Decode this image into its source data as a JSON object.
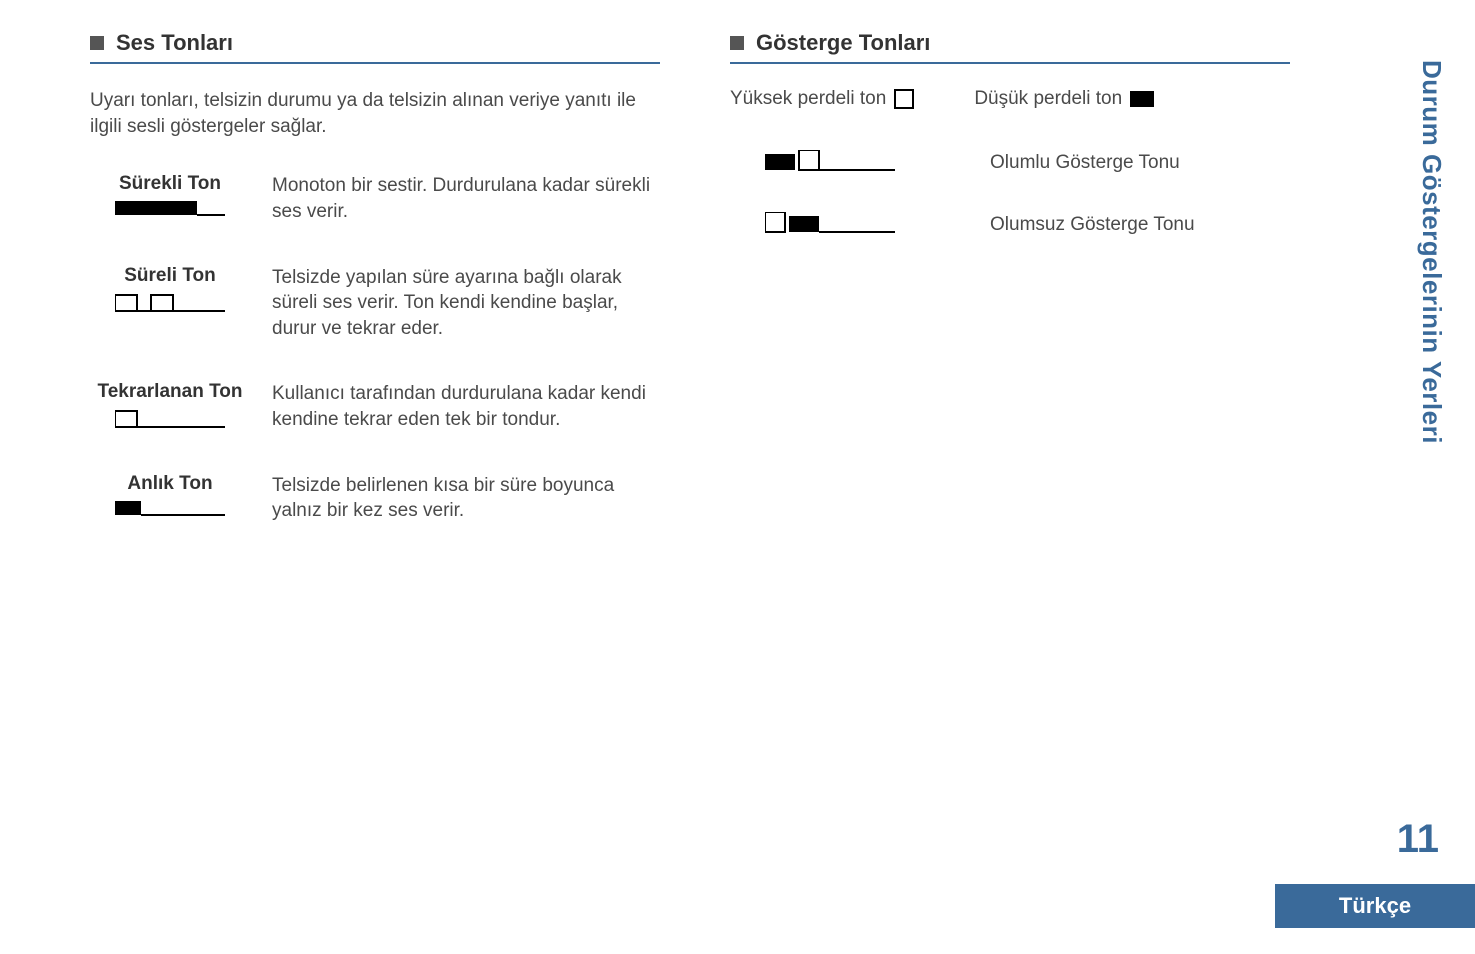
{
  "left": {
    "header": "Ses Tonları",
    "intro": "Uyarı tonları, telsizin durumu ya da telsizin alınan veriye yanıtı ile ilgili sesli göstergeler sağlar.",
    "tones": [
      {
        "label": "Sürekli Ton",
        "desc": "Monoton bir sestir. Durdurulana kadar sürekli ses verir.",
        "icon": "continuous"
      },
      {
        "label": "Süreli Ton",
        "desc": "Telsizde yapılan süre ayarına bağlı olarak süreli ses verir. Ton kendi kendine başlar, durur ve tekrar eder.",
        "icon": "periodic"
      },
      {
        "label": "Tekrarlanan Ton",
        "desc": "Kullanıcı tarafından durdurulana kadar kendi kendine tekrar eden tek bir tondur.",
        "icon": "repetitive"
      },
      {
        "label": "Anlık Ton",
        "desc": "Telsizde belirlenen kısa bir süre boyunca yalnız bir kez ses verir.",
        "icon": "momentary"
      }
    ]
  },
  "right": {
    "header": "Gösterge Tonları",
    "legend_high": "Yüksek perdeli ton",
    "legend_low": "Düşük perdeli ton",
    "indicators": [
      {
        "icon": "positive",
        "text": "Olumlu Gösterge Tonu"
      },
      {
        "icon": "negative",
        "text": "Olumsuz Gösterge Tonu"
      }
    ]
  },
  "side_tab": "Durum Göstergelerinin Yerleri",
  "page_number": "11",
  "language_tab": "Türkçe"
}
